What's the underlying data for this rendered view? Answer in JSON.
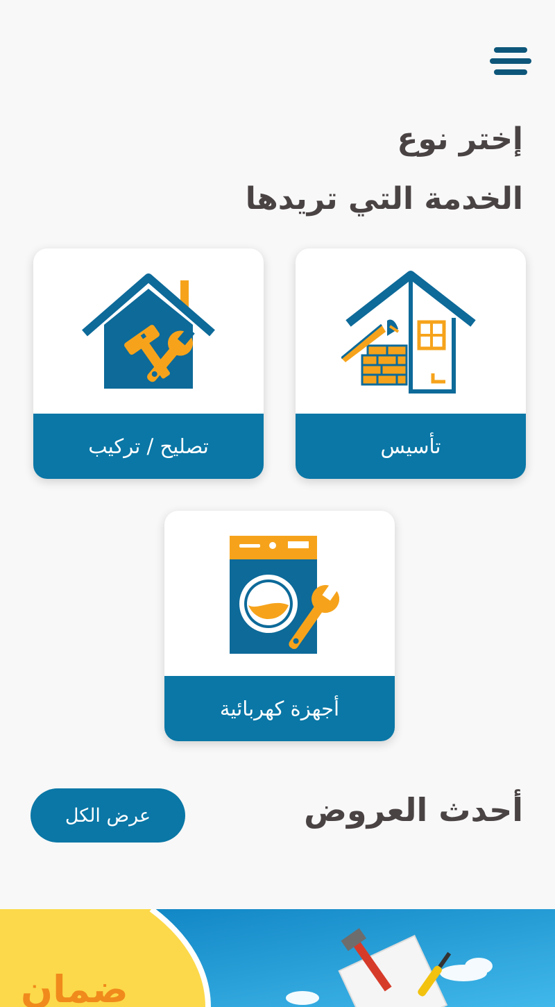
{
  "header": {
    "menu_icon": "hamburger-menu-icon",
    "title_line1": "إختر نوع",
    "title_line2": "الخدمة التي تريدها"
  },
  "services": [
    {
      "label": "تأسيس",
      "icon": "house-construction-icon"
    },
    {
      "label": "تصليح / تركيب",
      "icon": "house-repair-tools-icon"
    },
    {
      "label": "أجهزة كهربائية",
      "icon": "washing-machine-wrench-icon"
    }
  ],
  "offers": {
    "title": "أحدث العروض",
    "view_all_label": "عرض الكل"
  },
  "banner": {
    "text": "ضمان"
  },
  "colors": {
    "primary_blue": "#0a77a6",
    "icon_blue": "#0d6a99",
    "accent_orange": "#f6a31b",
    "title_text": "#4a4344",
    "background": "#f8f8f8",
    "banner_yellow": "#fcd94a"
  }
}
